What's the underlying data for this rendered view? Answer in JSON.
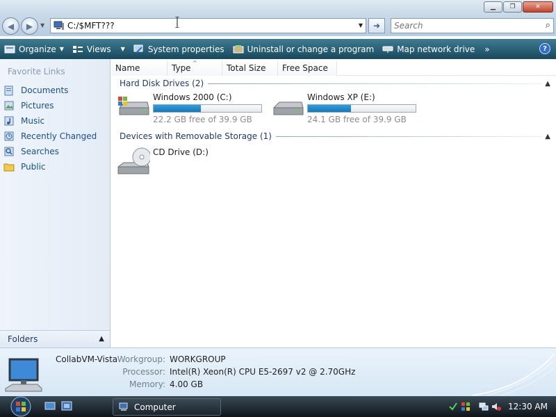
{
  "address_bar": {
    "value": "C:/$MFT???",
    "dropdown_icon": "chevron-down-icon",
    "go_icon": "arrow-right-icon"
  },
  "search": {
    "placeholder": "Search",
    "icon": "magnifier-icon"
  },
  "window_controls": {
    "minimize": "minimize-icon",
    "maximize": "maximize-icon",
    "close": "close-icon"
  },
  "toolbar": {
    "organize": "Organize",
    "views": "Views",
    "system_properties": "System properties",
    "uninstall": "Uninstall or change a program",
    "map_network": "Map network drive",
    "overflow": "»",
    "help": "?"
  },
  "sidebar": {
    "title": "Favorite Links",
    "items": [
      {
        "label": "Documents",
        "icon": "documents-icon"
      },
      {
        "label": "Pictures",
        "icon": "pictures-icon"
      },
      {
        "label": "Music",
        "icon": "music-icon"
      },
      {
        "label": "Recently Changed",
        "icon": "recently-changed-icon"
      },
      {
        "label": "Searches",
        "icon": "searches-icon"
      },
      {
        "label": "Public",
        "icon": "public-folder-icon"
      }
    ],
    "folders_label": "Folders"
  },
  "columns": [
    "Name",
    "Type",
    "Total Size",
    "Free Space"
  ],
  "groups": {
    "hard_disks": "Hard Disk Drives (2)",
    "removable": "Devices with Removable Storage (1)"
  },
  "drives": [
    {
      "name": "Windows 2000 (C:)",
      "free": "22.2 GB free of 39.9 GB",
      "used_fraction": 0.44
    },
    {
      "name": "Windows XP (E:)",
      "free": "24.1 GB free of 39.9 GB",
      "used_fraction": 0.4
    }
  ],
  "cd_drive": {
    "name": "CD Drive (D:)"
  },
  "details": {
    "computer_name": "CollabVM-Vista",
    "workgroup_label": "Workgroup:",
    "workgroup": "WORKGROUP",
    "processor_label": "Processor:",
    "processor": "Intel(R) Xeon(R) CPU E5-2697 v2 @ 2.70GHz",
    "memory_label": "Memory:",
    "memory": "4.00 GB"
  },
  "taskbar": {
    "active_window": "Computer",
    "clock": "12:30 AM"
  },
  "colors": {
    "toolbar": "#17495e",
    "link": "#1b4e94",
    "progress": "#1a76b9"
  }
}
